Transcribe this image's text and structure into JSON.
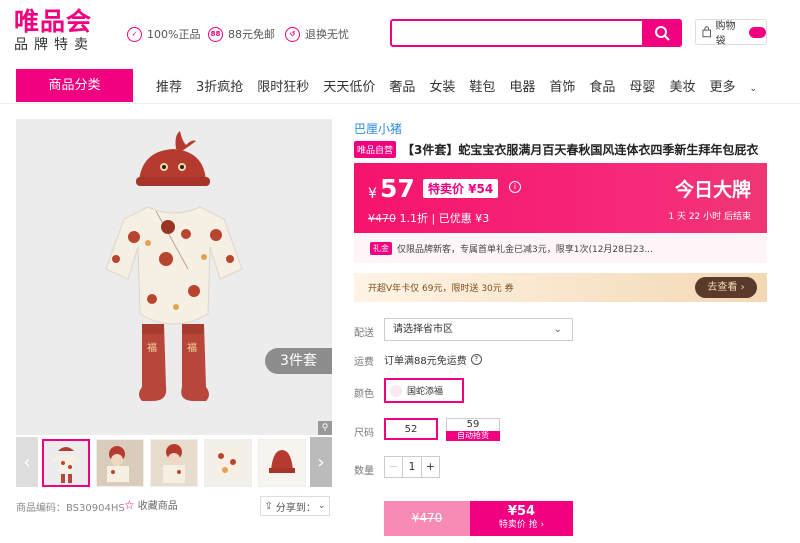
{
  "header": {
    "logo_main": "唯品会",
    "logo_sub": "品牌特卖",
    "promises": [
      {
        "icon": "shield-check-icon",
        "label": "100%正品"
      },
      {
        "icon": "88-badge-icon",
        "label": "88元免邮"
      },
      {
        "icon": "return-arrow-icon",
        "label": "退换无忧"
      }
    ],
    "search_placeholder": "",
    "cart_label": "购物袋",
    "cart_count": ""
  },
  "nav": {
    "category_label": "商品分类",
    "items": [
      "推荐",
      "3折疯抢",
      "限时狂秒",
      "天天低价",
      "奢品",
      "女装",
      "鞋包",
      "电器",
      "首饰",
      "食品",
      "母婴",
      "美妆",
      "更多"
    ]
  },
  "gallery": {
    "badge": "3件套",
    "product_code": "商品编码：BS30904HS",
    "collect_label": "收藏商品",
    "share_label": "分享到："
  },
  "product": {
    "brand": "巴厘小猪",
    "self_tag": "唯品自营",
    "title": "【3件套】蛇宝宝衣服满月百天春秋国风连体衣四季新生拜年包屁衣"
  },
  "price": {
    "currency": "¥",
    "value": "57",
    "special_tag": "特卖价 ¥54",
    "original": "¥470",
    "discount": "1.1折 | 已优惠 ¥3",
    "banner": "今日大牌",
    "countdown": "1 天 22 小时 后结束",
    "info_icon": "i"
  },
  "promo": {
    "tag": "礼金",
    "text": "仅限品牌新客，专属首单礼金已减3元，限享1次(12月28日23..."
  },
  "vip": {
    "text": "开超V年卡仅 69元，限时送 30元 券",
    "button": "去查看 ›"
  },
  "options": {
    "delivery_label": "配送",
    "delivery_value": "请选择省市区",
    "freight_label": "运费",
    "freight_value": "订单满88元免运费",
    "color_label": "颜色",
    "color_value": "国蛇添福",
    "size_label": "尺码",
    "size_selected": "52",
    "size_other": "59",
    "size_other_tag": "自动抢货",
    "qty_label": "数量",
    "qty_value": "1"
  },
  "buy": {
    "left_price": "¥470",
    "right_price": "¥54",
    "right_label": "特卖价 抢 ›"
  },
  "colors": {
    "brand_pink": "#f10180",
    "link_blue": "#2d8cd8"
  }
}
